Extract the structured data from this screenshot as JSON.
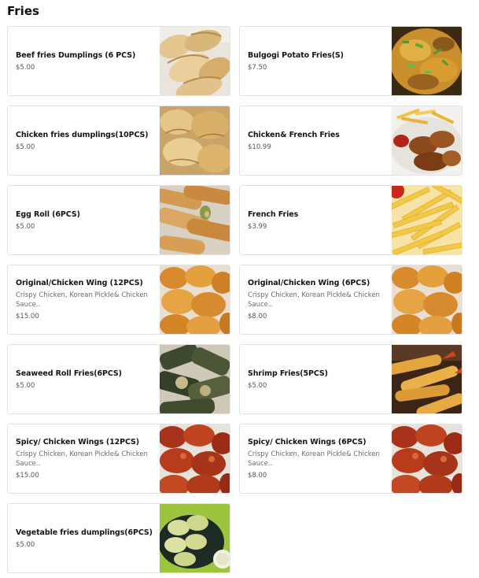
{
  "section": {
    "title": "Fries"
  },
  "items": [
    {
      "name": "Beef fries Dumplings (6 PCS)",
      "desc": "",
      "price": "$5.00",
      "image": "dumplings-photo"
    },
    {
      "name": "Bulgogi Potato Fries(S)",
      "desc": "",
      "price": "$7.50",
      "image": "loaded-fries-photo"
    },
    {
      "name": "Chicken fries dumplings(10PCS)",
      "desc": "",
      "price": "$5.00",
      "image": "fried-dumplings-photo"
    },
    {
      "name": "Chicken& French Fries",
      "desc": "",
      "price": "$10.99",
      "image": "wings-fries-photo"
    },
    {
      "name": "Egg Roll (6PCS)",
      "desc": "",
      "price": "$5.00",
      "image": "egg-roll-photo"
    },
    {
      "name": "French Fries",
      "desc": "",
      "price": "$3.99",
      "image": "french-fries-photo"
    },
    {
      "name": "Original/Chicken Wing (12PCS)",
      "desc": "Crispy Chicken, Korean Pickle& Chicken Sauce..",
      "price": "$15.00",
      "image": "fried-chicken-photo"
    },
    {
      "name": "Original/Chicken Wing (6PCS)",
      "desc": "Crispy Chicken, Korean Pickle& Chicken Sauce..",
      "price": "$8.00",
      "image": "fried-chicken-photo"
    },
    {
      "name": "Seaweed Roll Fries(6PCS)",
      "desc": "",
      "price": "$5.00",
      "image": "seaweed-roll-photo"
    },
    {
      "name": "Shrimp Fries(5PCS)",
      "desc": "",
      "price": "$5.00",
      "image": "fried-shrimp-photo"
    },
    {
      "name": "Spicy/ Chicken Wings (12PCS)",
      "desc": "Crispy Chicken, Korean Pickle& Chicken Sauce..",
      "price": "$15.00",
      "image": "spicy-wings-photo"
    },
    {
      "name": "Spicy/ Chicken Wings (6PCS)",
      "desc": "Crispy Chicken, Korean Pickle& Chicken Sauce..",
      "price": "$8.00",
      "image": "spicy-wings-photo"
    },
    {
      "name": "Vegetable fries dumplings(6PCS)",
      "desc": "",
      "price": "$5.00",
      "image": "steamed-dumplings-photo"
    }
  ],
  "colors": {
    "border": "#e2e2e2",
    "text": "#141414",
    "muted": "#6b6b6b"
  }
}
